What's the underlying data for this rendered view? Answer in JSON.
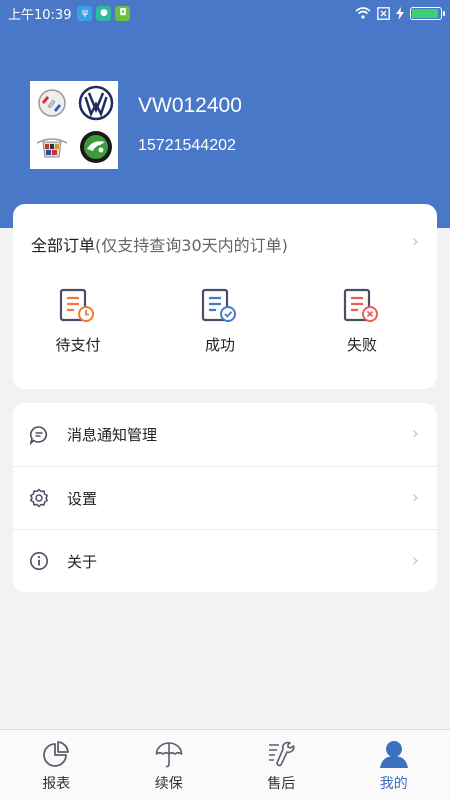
{
  "status_bar": {
    "time": "上午10:39",
    "battery_level": 0.92
  },
  "profile": {
    "account_id": "VW012400",
    "phone": "15721544202",
    "brand_logos": [
      "buick-logo",
      "volkswagen-logo",
      "cadillac-logo",
      "skoda-logo"
    ]
  },
  "orders": {
    "title": "全部订单",
    "note": "(仅支持查询30天内的订单)",
    "items": [
      {
        "label": "待支付",
        "icon": "pending-payment-icon"
      },
      {
        "label": "成功",
        "icon": "order-success-icon"
      },
      {
        "label": "失败",
        "icon": "order-failed-icon"
      }
    ]
  },
  "menu": {
    "items": [
      {
        "label": "消息通知管理",
        "icon": "message-icon"
      },
      {
        "label": "设置",
        "icon": "gear-icon"
      },
      {
        "label": "关于",
        "icon": "info-icon"
      }
    ]
  },
  "tabbar": {
    "items": [
      {
        "label": "报表",
        "icon": "pie-chart-icon"
      },
      {
        "label": "续保",
        "icon": "umbrella-icon"
      },
      {
        "label": "售后",
        "icon": "wrench-icon"
      },
      {
        "label": "我的",
        "icon": "user-icon",
        "active": true
      }
    ]
  },
  "colors": {
    "brand": "#4a78c8",
    "accent_orange": "#f07a3a",
    "accent_blue": "#4b79c9",
    "accent_red": "#ec5d57"
  }
}
